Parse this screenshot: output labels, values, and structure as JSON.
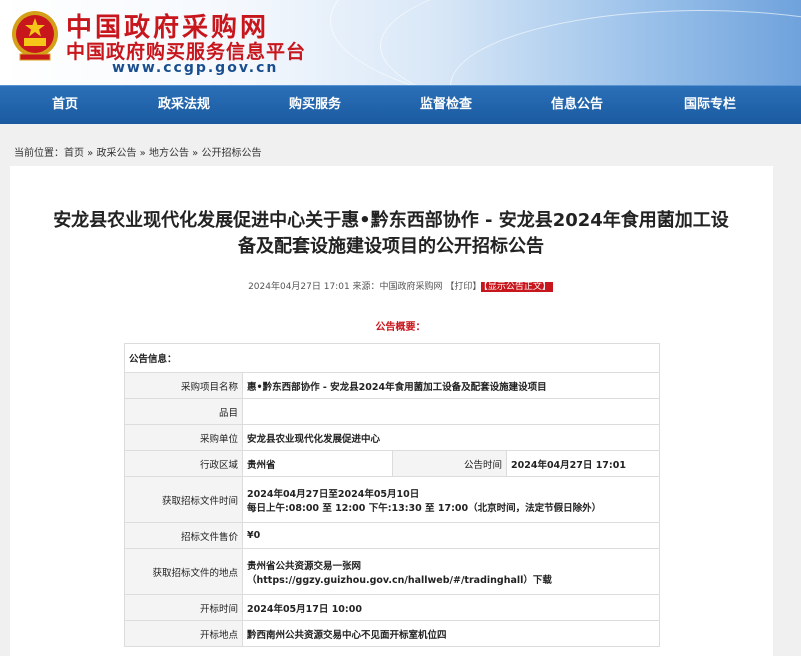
{
  "header": {
    "site_name": "中国政府采购网",
    "site_subtitle": "中国政府购买服务信息平台",
    "site_url": "www.ccgp.gov.cn",
    "brand_color": "#c8161d",
    "nav_color": "#1a5aa0"
  },
  "nav": [
    "首页",
    "政采法规",
    "购买服务",
    "监督检查",
    "信息公告",
    "国际专栏"
  ],
  "breadcrumb": {
    "prefix": "当前位置：",
    "items": [
      "首页",
      "政采公告",
      "地方公告",
      "公开招标公告"
    ],
    "sep": " » "
  },
  "article": {
    "title_line1": "安龙县农业现代化发展促进中心关于惠•黔东西部协作 - 安龙县2024年食用菌加工设",
    "title_line2": "备及配套设施建设项目的公开招标公告",
    "meta": "2024年04月27日 17:01 来源：中国政府采购网 【打印】",
    "show_button": "【显示公告正文】",
    "summary_heading": "公告概要："
  },
  "table": {
    "section": "公告信息：",
    "rows": {
      "project_label": "采购项目名称",
      "project_value": "惠•黔东西部协作 - 安龙县2024年食用菌加工设备及配套设施建设项目",
      "item_label": "品目",
      "item_value": "",
      "buyer_label": "采购单位",
      "buyer_value": "安龙县农业现代化发展促进中心",
      "region_label": "行政区域",
      "region_value": "贵州省",
      "pubtime_label": "公告时间",
      "pubtime_value": "2024年04月27日 17:01",
      "gettime_label": "获取招标文件时间",
      "gettime_value1": "2024年04月27日至2024年05月10日",
      "gettime_value2": "每日上午:08:00 至 12:00  下午:13:30 至 17:00（北京时间，法定节假日除外）",
      "price_label": "招标文件售价",
      "price_value": "¥0",
      "place_label": "获取招标文件的地点",
      "place_value1": "贵州省公共资源交易一张网",
      "place_value2": "（https://ggzy.guizhou.gov.cn/hallweb/#/tradinghall）下载",
      "opentime_label": "开标时间",
      "opentime_value": "2024年05月17日 10:00",
      "openplace_label": "开标地点",
      "openplace_value": "黔西南州公共资源交易中心不见面开标室机位四"
    }
  }
}
